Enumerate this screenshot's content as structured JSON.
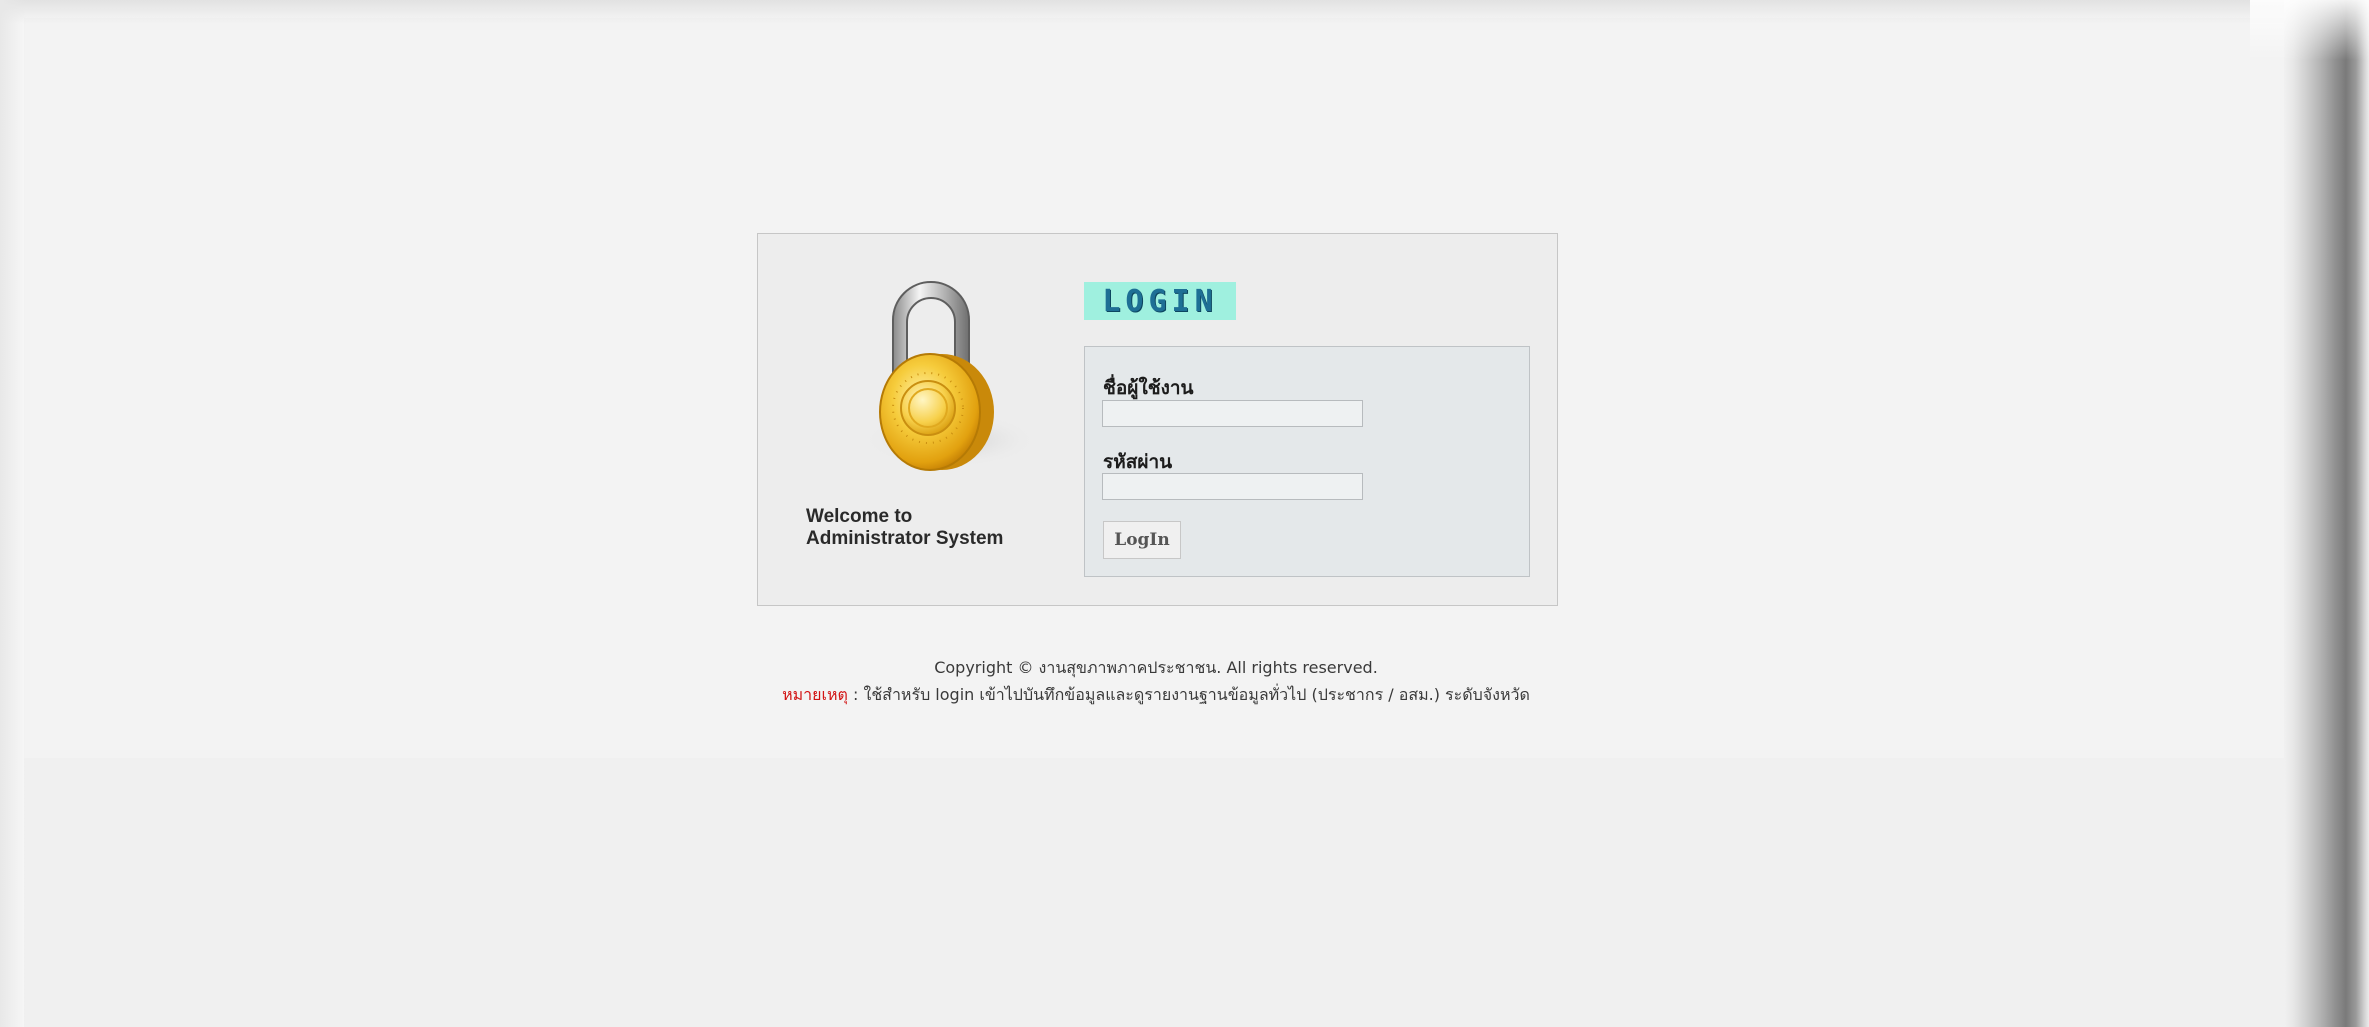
{
  "login_box": {
    "logo_text": "LOGIN",
    "welcome_line1": "Welcome to",
    "welcome_line2": "Administrator System",
    "username_label": "ชื่อผู้ใช้งาน",
    "username_value": "",
    "password_label": "รหัสผ่าน",
    "password_value": "",
    "login_button": "LogIn"
  },
  "footer": {
    "copyright": "Copyright © งานสุขภาพภาคประชาชน. All rights reserved.",
    "note_label": "หมายเหตุ",
    "note_text": " : ใช้สำหรับ login เข้าไปบันทึกข้อมูลและดูรายงานฐานข้อมูลทั่วไป (ประชากร / อสม.) ระดับจังหวัด"
  },
  "icons": {
    "padlock": "padlock-icon"
  },
  "colors": {
    "logo_bg": "#9ff0df",
    "logo_text": "#1e6f95",
    "note_label": "#d21313",
    "lock_gold": "#f2c12e"
  }
}
